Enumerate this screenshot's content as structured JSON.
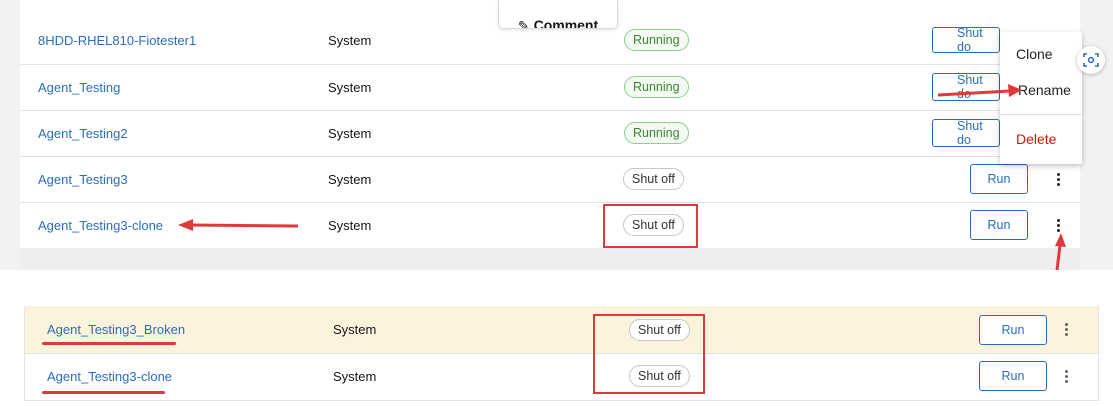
{
  "comment_tab": {
    "label": "Comment"
  },
  "top_table": {
    "rows": [
      {
        "name": "8HDD-RHEL810-Fiotester1",
        "type": "System",
        "status": "Running",
        "action": "Shut do"
      },
      {
        "name": "Agent_Testing",
        "type": "System",
        "status": "Running",
        "action": "Shut do"
      },
      {
        "name": "Agent_Testing2",
        "type": "System",
        "status": "Running",
        "action": "Shut do"
      },
      {
        "name": "Agent_Testing3",
        "type": "System",
        "status": "Shut off",
        "action": "Run"
      },
      {
        "name": "Agent_Testing3-clone",
        "type": "System",
        "status": "Shut off",
        "action": "Run"
      }
    ]
  },
  "context_menu": {
    "items": [
      "Clone",
      "Rename",
      "Delete"
    ]
  },
  "bottom_table": {
    "rows": [
      {
        "name": "Agent_Testing3_Broken",
        "type": "System",
        "status": "Shut off",
        "action": "Run"
      },
      {
        "name": "Agent_Testing3-clone",
        "type": "System",
        "status": "Shut off",
        "action": "Run"
      }
    ]
  },
  "colors": {
    "link": "#2a6ebb",
    "annotation_red": "#e0393b",
    "highlight_row": "#fbf3dc",
    "running_green": "#3e8635"
  }
}
